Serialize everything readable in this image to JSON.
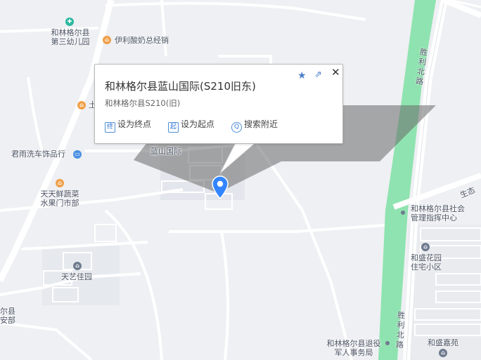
{
  "map": {
    "pois": [
      {
        "id": "kindergarten",
        "name_lines": [
          "和林格尔县",
          "第三幼儿园"
        ],
        "icon": "school-icon",
        "color": "#2bb8a0"
      },
      {
        "id": "yili",
        "name": "伊利酸奶总经销",
        "icon": "shop-icon",
        "color": "#f0a04a"
      },
      {
        "id": "tu",
        "name": "土",
        "icon": "shop-icon",
        "color": "#f0a04a"
      },
      {
        "id": "carwash",
        "name": "君雨洗车饰品行",
        "icon": "car-icon",
        "color": "#4a90e2"
      },
      {
        "id": "veg",
        "name_lines": [
          "天天鲜蔬菜",
          "水果门市部"
        ],
        "icon": "shop-icon",
        "color": "#f0a04a"
      },
      {
        "id": "lanshan",
        "name": "蓝山国际",
        "icon": "building-icon",
        "color": "#6f7b8f"
      },
      {
        "id": "tianyi",
        "name": "天艺佳园",
        "icon": "residence-icon",
        "color": "#6f7b8f"
      },
      {
        "id": "mgmt",
        "name_lines": [
          "和林格尔县社会",
          "管理指挥中心"
        ],
        "icon": "dot-icon",
        "color": "#6f7b8f"
      },
      {
        "id": "hesheng",
        "name_lines": [
          "和盛花园",
          "住宅小区"
        ],
        "icon": "residence-icon",
        "color": "#6f7b8f"
      },
      {
        "id": "veterans",
        "name_lines": [
          "和林格尔县退役",
          "军人事务局"
        ],
        "icon": "dot-icon",
        "color": "#6f7b8f"
      },
      {
        "id": "heshengjia",
        "name": "和盛嘉苑",
        "icon": "residence-icon",
        "color": "#6f7b8f"
      },
      {
        "id": "edge",
        "name_lines": [
          "尔县",
          "安部"
        ],
        "icon": "",
        "color": "#6f7b8f"
      }
    ],
    "roads": {
      "shengli_top": "胜利北路",
      "shengli_bottom": "胜利北路",
      "shengtai": "生态"
    },
    "colors": {
      "background": "#eef0f3",
      "road": "#ffffff",
      "green_belt": "#8fe3b0",
      "pin": "#3385ff"
    }
  },
  "popup": {
    "title": "和林格尔县蓝山国际(S210旧东)",
    "address": "和林格尔县S210(旧)",
    "actions": [
      {
        "icon_char": "终",
        "label": "设为终点"
      },
      {
        "icon_char": "起",
        "label": "设为起点"
      },
      {
        "icon_char": "Q",
        "label": "搜索附近"
      }
    ],
    "icons": {
      "star": "star-icon",
      "share": "share-icon",
      "close": "close-icon"
    }
  }
}
